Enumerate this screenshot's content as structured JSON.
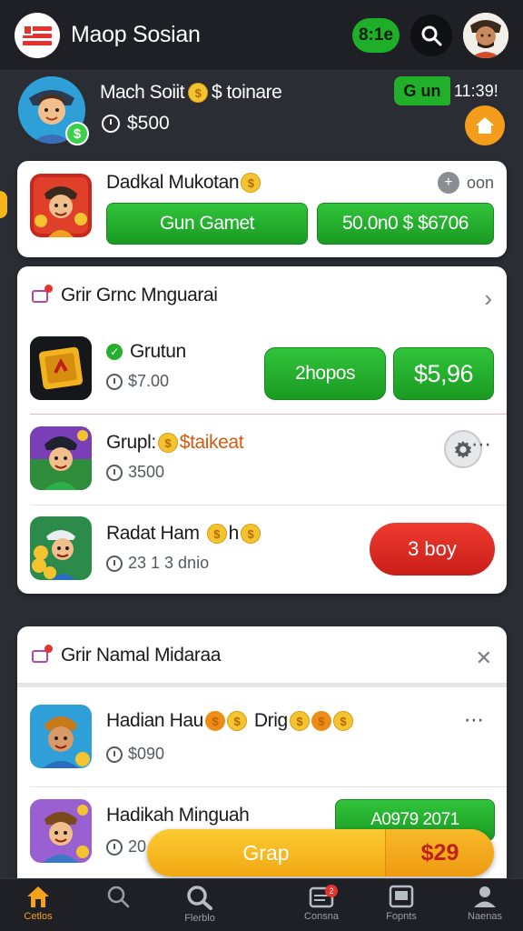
{
  "header": {
    "title": "Maop Sosian",
    "badge": "8:1e"
  },
  "profile": {
    "name": "Mach Soiit",
    "name_suffix": "$ toinare",
    "balance": "$500",
    "status_label": "G un",
    "status_time": "11:39!"
  },
  "featured": {
    "title": "Dadkal Mukotan",
    "count_label": "oon",
    "play_button": "Gun Gamet",
    "price_button": "50.0n0 $ $6706"
  },
  "section1": {
    "title": "Grir Grnc Mnguarai",
    "items": [
      {
        "title": "Grutun",
        "sub": "$7.00",
        "btn_primary": "2hopos",
        "btn_price": "$5,96"
      },
      {
        "title": "Grupl:",
        "title_suffix": "$taikeat",
        "sub": "3500"
      },
      {
        "title": "Radat Ham",
        "title_suffix": "h",
        "sub": "23 1 3 dnio",
        "btn_red": "3 boy"
      }
    ]
  },
  "section2": {
    "title": "Grir Namal Midaraa",
    "items": [
      {
        "title": "Hadian Hau",
        "title_mid": "Drig",
        "sub": "$090"
      },
      {
        "title": "Hadikah Minguah",
        "sub": "20",
        "btn_price": "A0979 2071"
      }
    ]
  },
  "grab_bar": {
    "label": "Grap",
    "price": "$29"
  },
  "bottom_nav": [
    {
      "label": "Cetlos",
      "icon": "home-icon"
    },
    {
      "label": "",
      "icon": "search-icon"
    },
    {
      "label": "Flerblo",
      "icon": "search-icon"
    },
    {
      "label": "Consna",
      "icon": "calendar-icon",
      "badge": "2"
    },
    {
      "label": "Fopnts",
      "icon": "window-icon"
    },
    {
      "label": "Naenas",
      "icon": "person-icon"
    }
  ],
  "colors": {
    "accent_green": "#1fae2a",
    "accent_orange": "#f59d1a",
    "accent_red": "#e5322d",
    "background": "#2a2d34"
  }
}
